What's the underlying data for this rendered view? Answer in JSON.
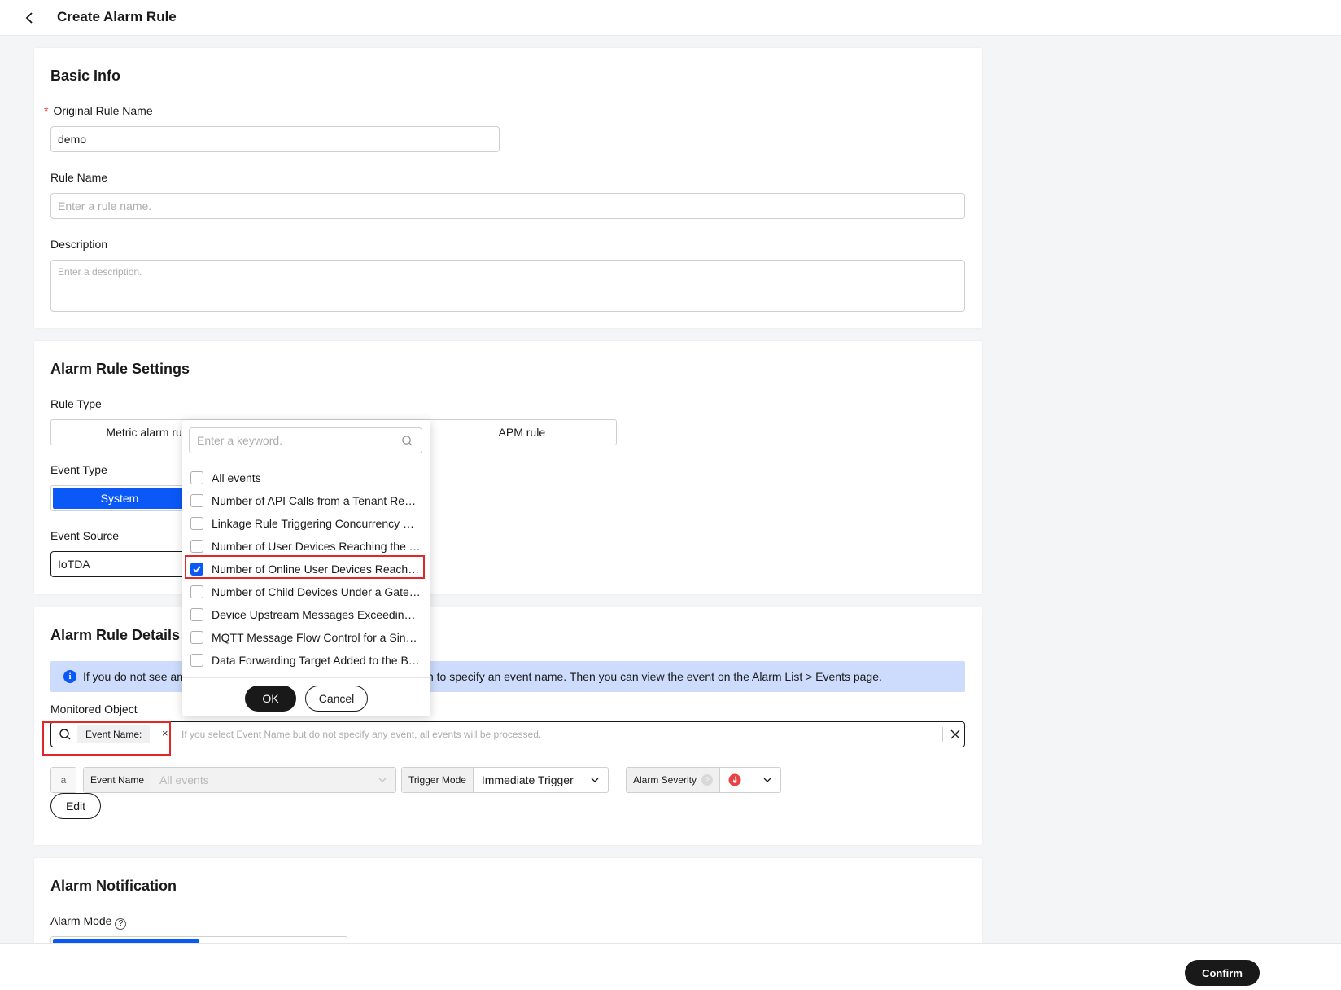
{
  "header": {
    "title": "Create Alarm Rule"
  },
  "basic_info": {
    "title": "Basic Info",
    "original_rule_name": {
      "label": "Original Rule Name",
      "required_mark": "*",
      "value": "demo"
    },
    "rule_name": {
      "label": "Rule Name",
      "placeholder": "Enter a rule name."
    },
    "description": {
      "label": "Description",
      "placeholder": "Enter a description."
    }
  },
  "settings": {
    "title": "Alarm Rule Settings",
    "rule_type": {
      "label": "Rule Type",
      "options": [
        "Metric alarm rul",
        "APM rule"
      ]
    },
    "event_type": {
      "label": "Event Type",
      "selected": "System"
    },
    "event_source": {
      "label": "Event Source",
      "value": "IoTDA"
    }
  },
  "details": {
    "title": "Alarm Rule Details",
    "info_left": "If you do not see an",
    "info_right": "n to specify an event name. Then you can view the event on the Alarm List > Events page.",
    "monitored_object": {
      "label": "Monitored Object",
      "tag": "Event Name:",
      "tag_remove": "×",
      "placeholder": "If you select Event Name but do not specify any event, all events will be processed."
    },
    "condition": {
      "index": "a",
      "event_name_label": "Event Name",
      "event_name_value": "All events",
      "trigger_mode_label": "Trigger Mode",
      "trigger_mode_value": "Immediate Trigger",
      "severity_label": "Alarm Severity",
      "severity_help": "?"
    },
    "edit_button": "Edit"
  },
  "notification": {
    "title": "Alarm Notification",
    "alarm_mode_label": "Alarm Mode",
    "alarm_mode_help": "?"
  },
  "dropdown": {
    "search_placeholder": "Enter a keyword.",
    "items": [
      {
        "label": "All events",
        "checked": false
      },
      {
        "label": "Number of API Calls from a Tenant Reaching the Threshold",
        "checked": false
      },
      {
        "label": "Linkage Rule Triggering Concurrency Reaching the Threshold",
        "checked": false
      },
      {
        "label": "Number of User Devices Reaching the Threshold",
        "checked": false
      },
      {
        "label": "Number of Online User Devices Reaching the Threshold",
        "checked": true
      },
      {
        "label": "Number of Child Devices Under a Gateway Reaching the Threshold",
        "checked": false
      },
      {
        "label": "Device Upstream Messages Exceeding the Threshold",
        "checked": false
      },
      {
        "label": "MQTT Message Flow Control for a Single Device",
        "checked": false
      },
      {
        "label": "Data Forwarding Target Added to the Blocklist",
        "checked": false
      }
    ],
    "ok_label": "OK",
    "cancel_label": "Cancel"
  },
  "footer": {
    "confirm_label": "Confirm"
  },
  "colors": {
    "primary": "#0a59f7",
    "highlight": "#e02828",
    "info_bg": "#cddcfc",
    "severity": "#e84343"
  }
}
